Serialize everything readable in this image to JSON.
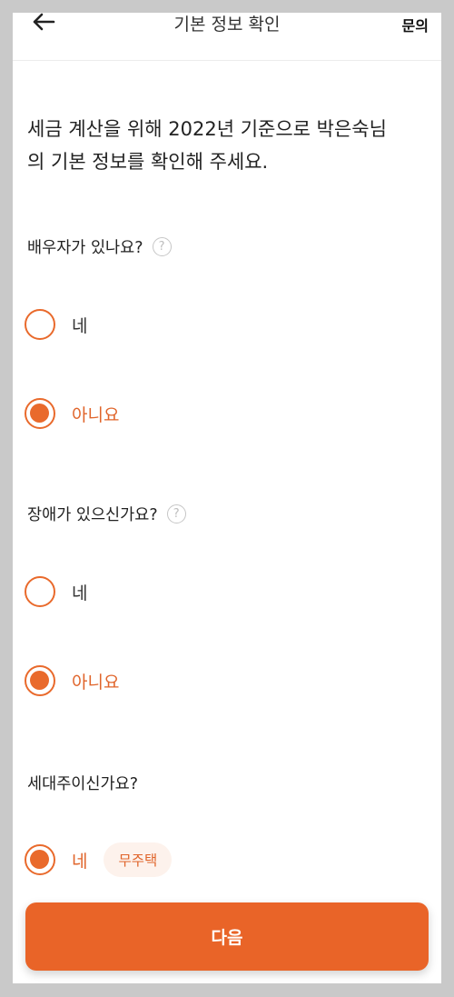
{
  "header": {
    "back_icon": "arrow-left-icon",
    "title": "기본 정보 확인",
    "inquiry_label": "문의"
  },
  "intro": {
    "line1": "세금 계산을 위해 2022년 기준으로 박은숙님",
    "line2": "의 기본 정보를 확인해 주세요."
  },
  "questions": [
    {
      "label": "배우자가 있나요?",
      "help_icon": "?",
      "options": [
        {
          "label": "네",
          "selected": false
        },
        {
          "label": "아니요",
          "selected": true
        }
      ]
    },
    {
      "label": "장애가 있으신가요?",
      "help_icon": "?",
      "options": [
        {
          "label": "네",
          "selected": false
        },
        {
          "label": "아니요",
          "selected": true
        }
      ]
    },
    {
      "label": "세대주이신가요?",
      "options": [
        {
          "label": "네",
          "selected": true,
          "tag": "무주택"
        }
      ]
    }
  ],
  "footer": {
    "next_label": "다음"
  },
  "colors": {
    "accent": "#e96428",
    "tag_bg": "#fdf2ec"
  }
}
